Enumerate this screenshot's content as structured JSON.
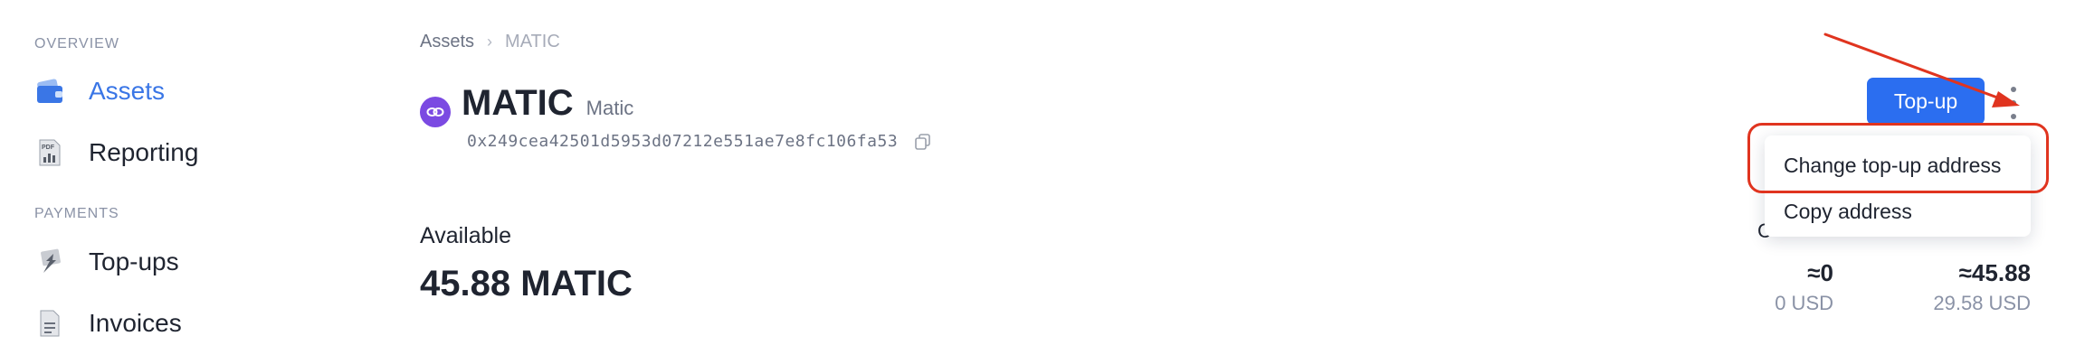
{
  "sidebar": {
    "sections": [
      {
        "label": "OVERVIEW",
        "items": [
          {
            "label": "Assets",
            "icon": "wallet-icon",
            "active": true
          },
          {
            "label": "Reporting",
            "icon": "pdf-report-icon",
            "active": false
          }
        ]
      },
      {
        "label": "PAYMENTS",
        "items": [
          {
            "label": "Top-ups",
            "icon": "topup-arrow-icon",
            "active": false
          },
          {
            "label": "Invoices",
            "icon": "invoice-icon",
            "active": false
          }
        ]
      }
    ]
  },
  "breadcrumb": {
    "root": "Assets",
    "separator": "›",
    "current": "MATIC"
  },
  "asset": {
    "symbol": "MATIC",
    "name": "Matic",
    "icon": "polygon-icon",
    "address": "0x249cea42501d5953d07212e551ae7e8fc106fa53"
  },
  "balance": {
    "label": "Available",
    "value": "45.88 MATIC"
  },
  "actions": {
    "topup_label": "Top-up",
    "more_icon": "kebab-menu-icon"
  },
  "dropdown": {
    "items": [
      "Change top-up address",
      "Copy address"
    ]
  },
  "balances_columns": [
    {
      "header": "C",
      "approx": "≈0",
      "usd": "0 USD"
    },
    {
      "header": "",
      "approx": "≈45.88",
      "usd": "29.58 USD"
    }
  ],
  "colors": {
    "accent": "#2b6ef0",
    "active_nav": "#3a76e6",
    "annotation": "#e0341f",
    "coin": "#7b4ae2"
  }
}
